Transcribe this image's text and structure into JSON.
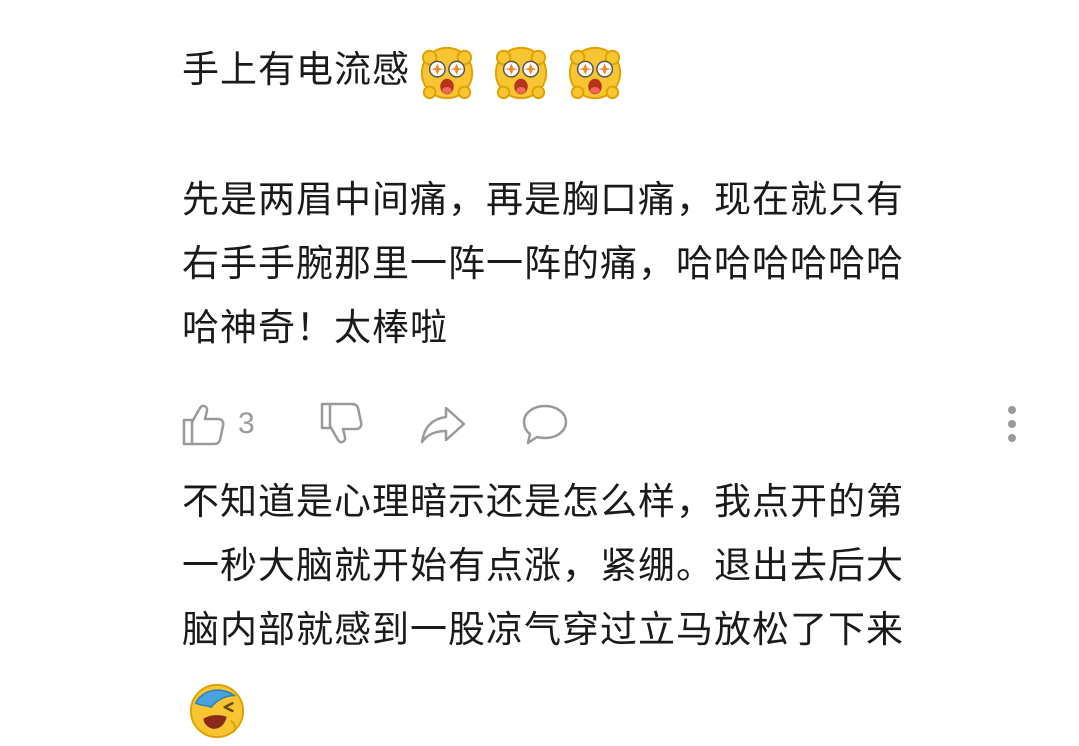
{
  "comment_1": {
    "text": "手上有电流感",
    "emojis": [
      "starry-eyed-face-icon",
      "starry-eyed-face-icon",
      "starry-eyed-face-icon"
    ]
  },
  "reply": {
    "lines": [
      "先是两眉中间痛，再是胸口痛，现在就只有",
      "右手手腕那里一阵一阵的痛，哈哈哈哈哈哈",
      "哈神奇！太棒啦"
    ]
  },
  "actions": {
    "like_count": "3",
    "icons": [
      "thumbs-up-icon",
      "thumbs-down-icon",
      "share-icon",
      "comment-icon",
      "more-icon"
    ]
  },
  "comment_2": {
    "lines": [
      "不知道是心理暗示还是怎么样，我点开的第",
      "一秒大脑就开始有点涨，紧绷。退出去后大",
      "脑内部就感到一股凉气穿过立马放松了下来"
    ],
    "emoji": "laughing-face-icon"
  },
  "colors": {
    "text": "#1a1a1a",
    "icon_gray": "#9a9a9a",
    "emoji_yellow": "#f7c531",
    "emoji_outline": "#e0a100"
  }
}
